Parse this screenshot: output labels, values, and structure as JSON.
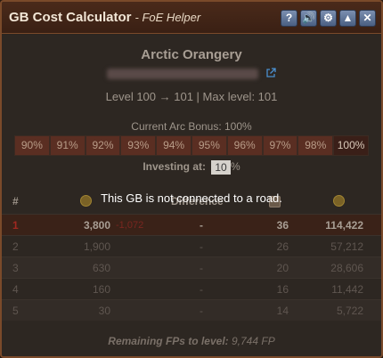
{
  "window": {
    "title": "GB Cost Calculator",
    "subtitle": "- FoE Helper",
    "buttons": [
      {
        "name": "help-button",
        "glyph": "?"
      },
      {
        "name": "sound-button",
        "glyph": "🔊"
      },
      {
        "name": "settings-button",
        "glyph": "⚙"
      },
      {
        "name": "minimize-button",
        "glyph": "▲"
      },
      {
        "name": "close-button",
        "glyph": "✕"
      }
    ]
  },
  "gb": {
    "name": "Arctic Orangery",
    "level_line": "Level 100 → 101 | Max level: 101"
  },
  "arc_bonus": {
    "title": "Current Arc Bonus: 100%",
    "options": [
      "90%",
      "91%",
      "92%",
      "93%",
      "94%",
      "95%",
      "96%",
      "97%",
      "98%",
      "100%"
    ],
    "selected": "100%"
  },
  "investing": {
    "label": "Investing at:",
    "value": "10",
    "unit": "%"
  },
  "table": {
    "col_num": "#",
    "col_diff": "Difference",
    "rows": [
      {
        "num": "1",
        "cost": "3,800",
        "loss": "-1,072",
        "diff": "-",
        "rank": "36",
        "total": "114,422"
      },
      {
        "num": "2",
        "cost": "1,900",
        "loss": "",
        "diff": "-",
        "rank": "26",
        "total": "57,212"
      },
      {
        "num": "3",
        "cost": "630",
        "loss": "",
        "diff": "-",
        "rank": "20",
        "total": "28,606"
      },
      {
        "num": "4",
        "cost": "160",
        "loss": "",
        "diff": "-",
        "rank": "16",
        "total": "11,442"
      },
      {
        "num": "5",
        "cost": "30",
        "loss": "",
        "diff": "-",
        "rank": "14",
        "total": "5,722"
      }
    ]
  },
  "notice": "This GB is not connected to a road.",
  "footer": {
    "label": "Remaining FPs to level:",
    "value": "9,744 FP"
  },
  "colors": {
    "frame": "#7a4a2a",
    "pct_button": "#5a2e22",
    "loss_red": "#7a2620",
    "title_button": "#5d7196"
  }
}
